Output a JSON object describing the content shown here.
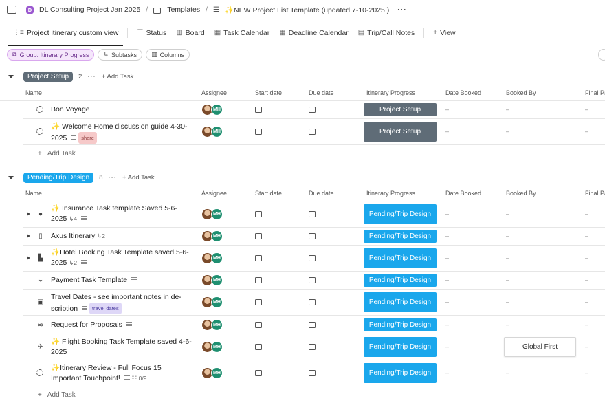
{
  "breadcrumb": {
    "space_badge": "D",
    "space": "DL Consulting Project Jan 2025",
    "folder": "Templates",
    "list": "✨NEW Project List Template (updated 7-10-2025 )"
  },
  "tabs": [
    {
      "label": "Project itinerary custom view",
      "icon": "hierarchy-icon"
    },
    {
      "label": "Status",
      "icon": "list-icon"
    },
    {
      "label": "Board",
      "icon": "board-icon"
    },
    {
      "label": "Task Calendar",
      "icon": "calendar-icon"
    },
    {
      "label": "Deadline Calendar",
      "icon": "calendar-icon"
    },
    {
      "label": "Trip/Call Notes",
      "icon": "doc-icon"
    },
    {
      "label": "View",
      "icon": "plus-icon"
    }
  ],
  "chips": {
    "group": "Group: Itinerary Progress",
    "subtasks": "Subtasks",
    "columns": "Columns"
  },
  "columns": {
    "name": "Name",
    "assignee": "Assignee",
    "start": "Start date",
    "due": "Due date",
    "progress": "Itinerary Progress",
    "date_booked": "Date Booked",
    "booked_by": "Booked By",
    "final": "Final Pa"
  },
  "colors": {
    "project_setup": "#5f6c77",
    "pending_trip": "#1aa7ec",
    "accent_purple": "#9b59d0"
  },
  "add_task_label": "Add Task",
  "empty_dash": "–",
  "groups": [
    {
      "name": "Project Setup",
      "count": "2",
      "tasks": [
        {
          "name": "Bon Voyage",
          "icon": "circle-status-icon",
          "meta": "",
          "tag": "",
          "progress": "Project Setup"
        },
        {
          "name": "✨ Welcome Home discussion guide 4-30-2025",
          "icon": "circle-status-icon",
          "meta": "",
          "tag": "share",
          "progress": "Project Setup"
        }
      ]
    },
    {
      "name": "Pending/Trip Design",
      "count": "8",
      "tasks": [
        {
          "name": "✨ Insurance Task template Saved 5-6-2025",
          "icon": "apple-icon",
          "meta": "4",
          "tag": "",
          "progress": "Pending/Trip Design"
        },
        {
          "name": "Axus Itinerary",
          "icon": "phone-icon",
          "meta": "2",
          "tag": "",
          "progress": "Pending/Trip Design"
        },
        {
          "name": "✨Hotel Booking Task Template saved 5-6-2025",
          "icon": "hotel-icon",
          "meta": "2",
          "tag": "",
          "progress": "Pending/Trip Design"
        },
        {
          "name": "Payment Task Template",
          "icon": "payment-icon",
          "meta": "",
          "tag": "",
          "progress": "Pending/Trip Design"
        },
        {
          "name": "Travel Dates - see important notes in de-scription",
          "icon": "calendar-check-icon",
          "meta": "",
          "tag": "travel dates",
          "progress": "Pending/Trip Design"
        },
        {
          "name": "Request for Proposals",
          "icon": "handshake-icon",
          "meta": "",
          "tag": "",
          "progress": "Pending/Trip Design"
        },
        {
          "name": "✨ Flight Booking Task Template saved 4-6-2025",
          "icon": "plane-icon",
          "meta": "",
          "tag": "",
          "progress": "Pending/Trip Design",
          "booked_by": "Global First"
        },
        {
          "name": "✨Itinerary Review - Full Focus 15 Important Touchpoint!",
          "icon": "circle-status-icon",
          "meta": "0/9",
          "tag": "",
          "progress": "Pending/Trip Design"
        }
      ]
    }
  ],
  "assignee_initials": "MH"
}
